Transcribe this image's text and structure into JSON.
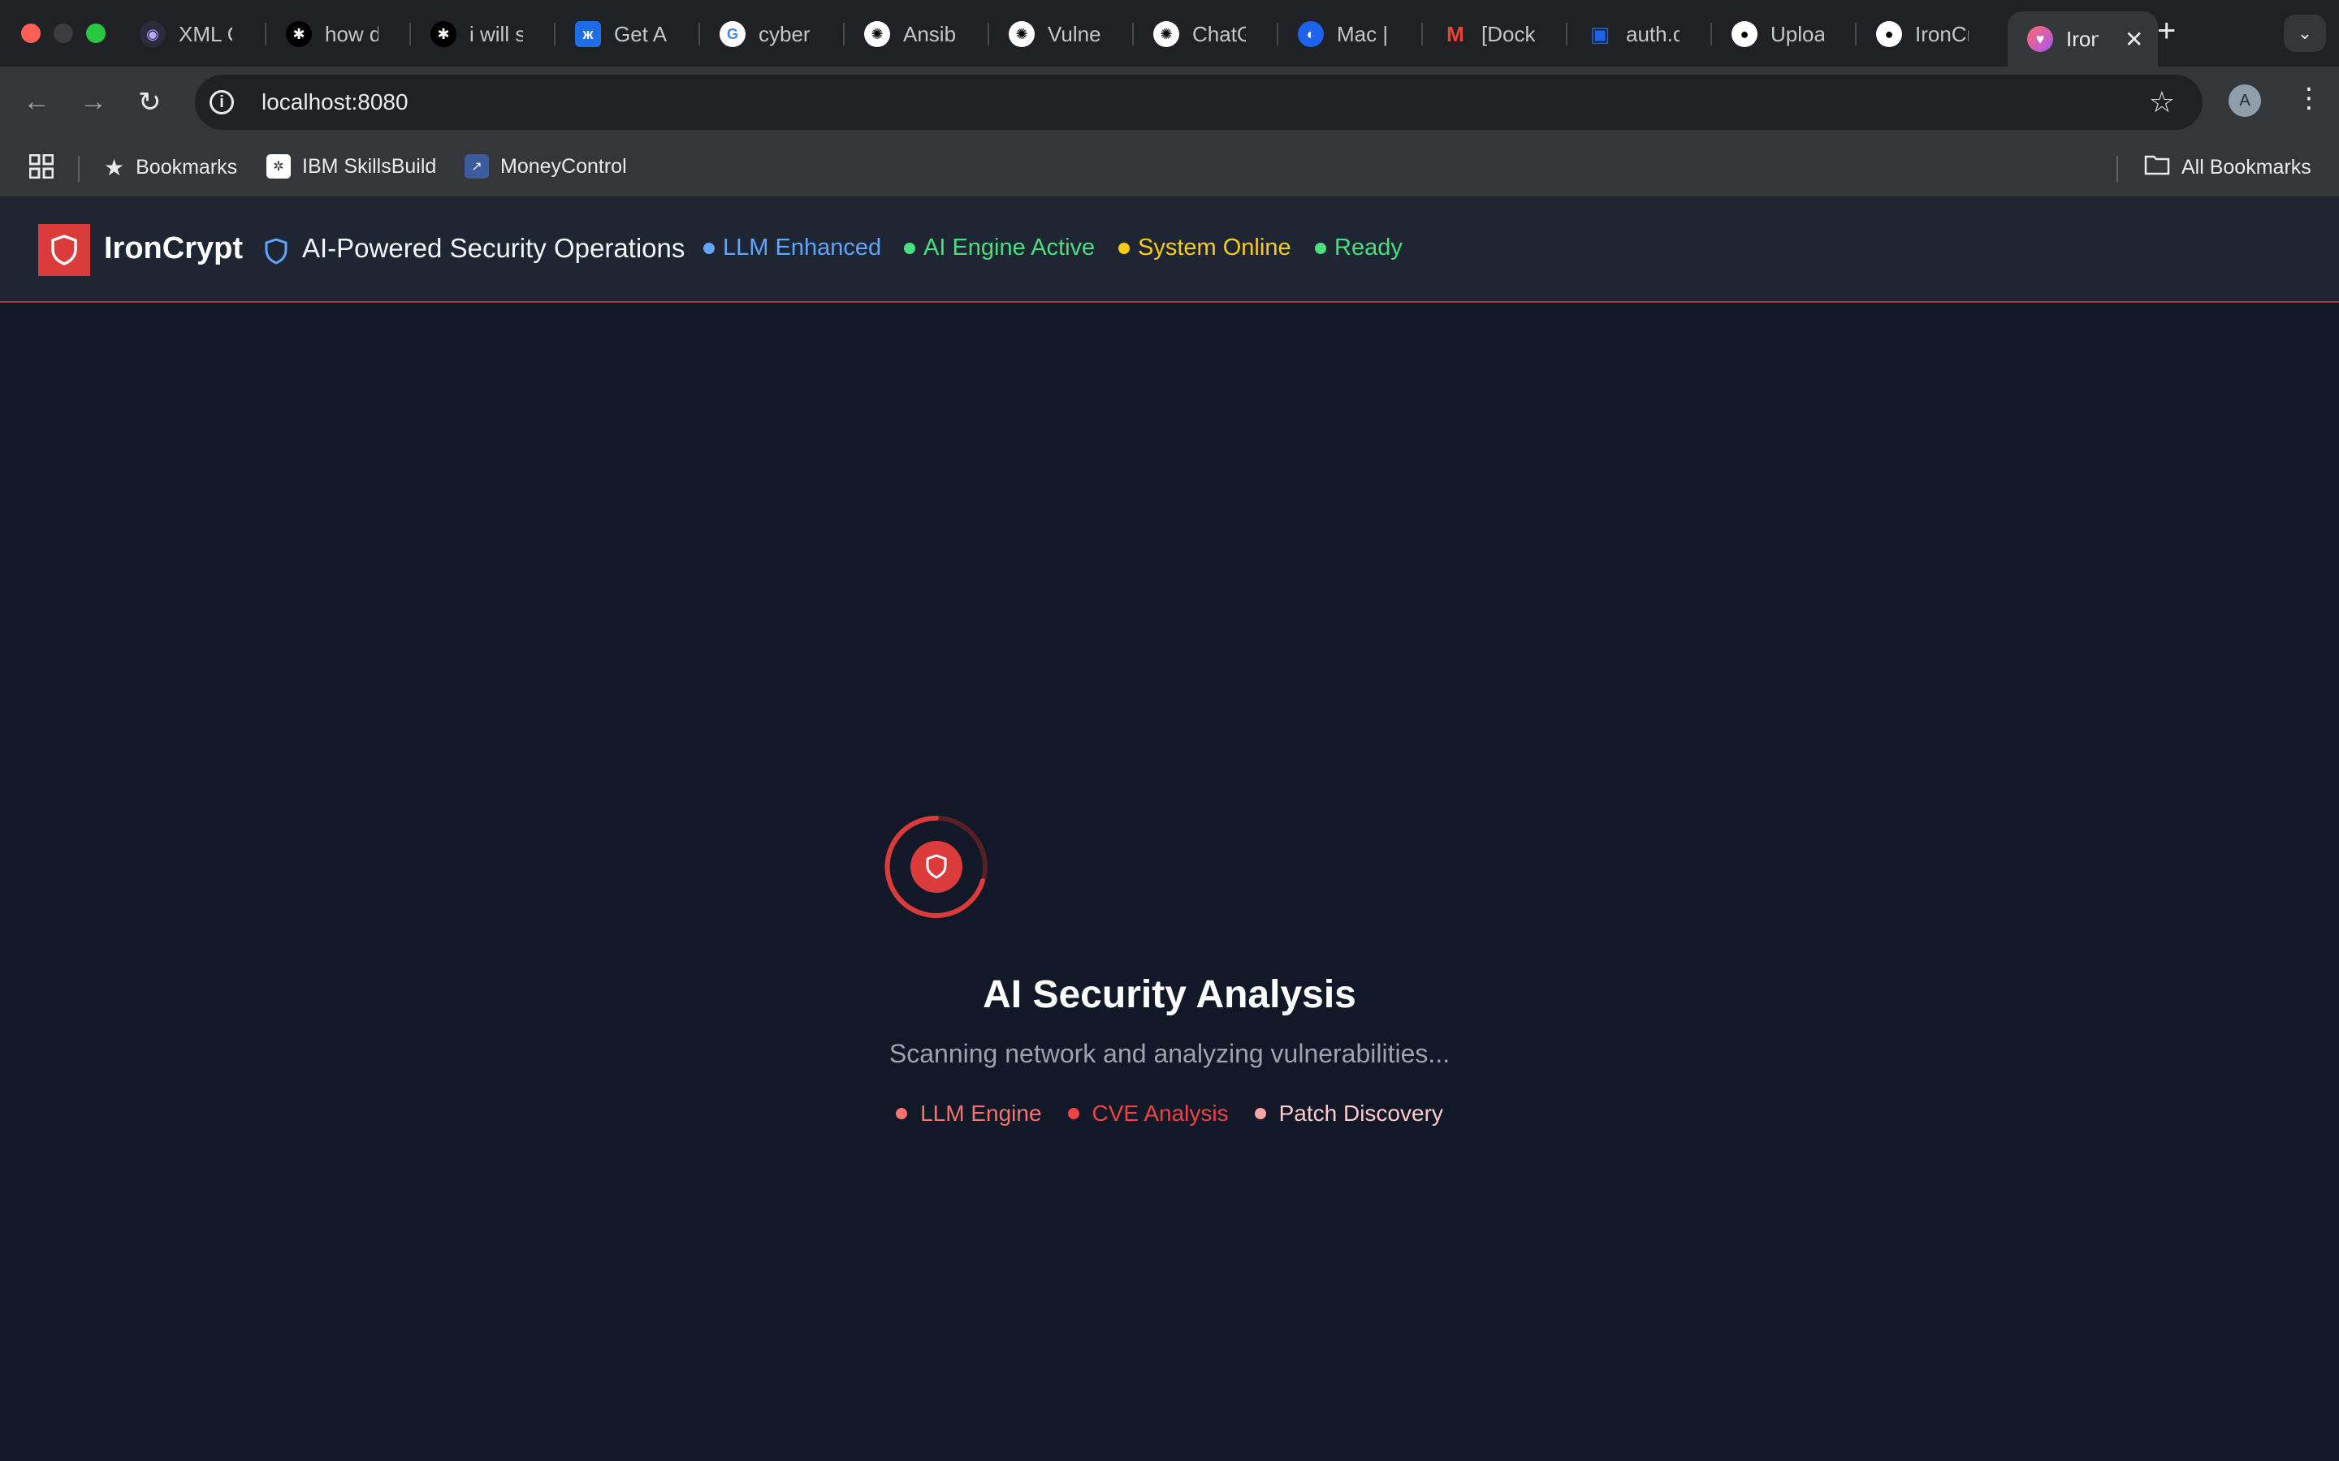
{
  "browser": {
    "tabs": [
      {
        "label": "XML Ou",
        "favicon": "eye-icon",
        "color": "#6a5acd"
      },
      {
        "label": "how do",
        "favicon": "spider-icon",
        "color": "#000000"
      },
      {
        "label": "i will sh",
        "favicon": "spider-icon",
        "color": "#000000"
      },
      {
        "label": "Get API",
        "favicon": "butterfly-icon",
        "color": "#1d6ee6"
      },
      {
        "label": "cyber s",
        "favicon": "google-icon",
        "color": "#ffffff"
      },
      {
        "label": "Ansible",
        "favicon": "chatgpt-icon",
        "color": "#ffffff"
      },
      {
        "label": "Vulnera",
        "favicon": "chatgpt-icon",
        "color": "#ffffff"
      },
      {
        "label": "ChatGP",
        "favicon": "chatgpt-icon",
        "color": "#ffffff"
      },
      {
        "label": "Mac | D",
        "favicon": "docker-round-icon",
        "color": "#1d63ed"
      },
      {
        "label": "[Docke",
        "favicon": "gmail-icon",
        "color": "#ea4335"
      },
      {
        "label": "auth.do",
        "favicon": "docker-icon",
        "color": "#1d63ed"
      },
      {
        "label": "Upload",
        "favicon": "github-icon",
        "color": "#ffffff"
      },
      {
        "label": "IronCry",
        "favicon": "github-icon",
        "color": "#ffffff"
      }
    ],
    "active_tab": {
      "label": "Iron",
      "favicon": "heart-icon",
      "close": "✕"
    },
    "new_tab": "+",
    "tab_menu": "⌄",
    "url": "localhost:8080",
    "avatar_letter": "A",
    "bookmarks": [
      {
        "label": "Bookmarks",
        "icon": "star-icon"
      },
      {
        "label": "IBM SkillsBuild",
        "icon": "ibm-icon"
      },
      {
        "label": "MoneyControl",
        "icon": "moneycontrol-icon"
      }
    ],
    "all_bookmarks": "All Bookmarks"
  },
  "header": {
    "brand": "IronCrypt",
    "subtitle": "AI-Powered Security Operations",
    "statuses": [
      {
        "label": "LLM Enhanced",
        "color": "#60a5fa"
      },
      {
        "label": "AI Engine Active",
        "color": "#4ade80"
      },
      {
        "label": "System Online",
        "color": "#facc15"
      },
      {
        "label": "Ready",
        "color": "#4ade80"
      }
    ]
  },
  "loading": {
    "title": "AI Security Analysis",
    "subtitle": "Scanning network and analyzing vulnerabilities...",
    "chips": [
      {
        "label": "LLM Engine",
        "color": "#f87171",
        "dot": "#f87171"
      },
      {
        "label": "CVE Analysis",
        "color": "#ef4444",
        "dot": "#ef4444"
      },
      {
        "label": "Patch Discovery",
        "color": "#fecaca",
        "dot": "#fca5a5"
      }
    ]
  },
  "colors": {
    "accent": "#dc3b3b",
    "background": "#111827",
    "header_bg": "#1e2633"
  }
}
